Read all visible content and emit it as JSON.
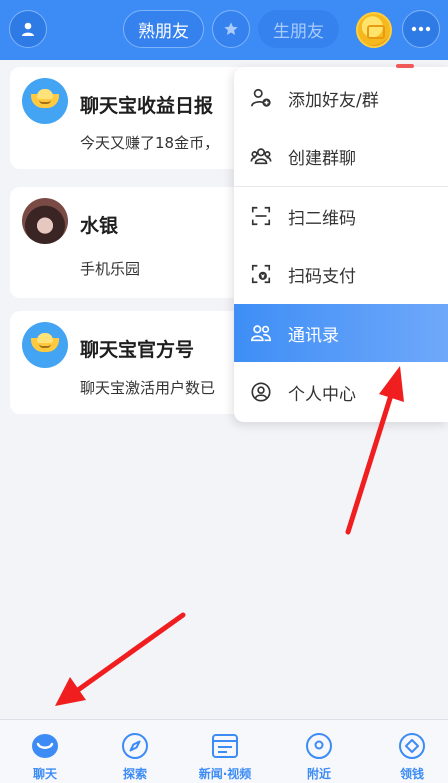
{
  "header": {
    "familiar_label": "熟朋友",
    "stranger_label": "生朋友",
    "avatar_icon": "user-icon",
    "star_icon": "star-icon",
    "coin_icon": "coin-icon",
    "more_icon": "more-dots-icon"
  },
  "chats": [
    {
      "title": "聊天宝收益日报",
      "preview": "今天又赚了18金币，",
      "avatar": "ingot-logo"
    },
    {
      "title": "水银",
      "preview": "手机乐园",
      "avatar": "user-photo"
    },
    {
      "title": "聊天宝官方号",
      "preview": "聊天宝激活用户数已",
      "avatar": "ingot-logo"
    }
  ],
  "menu": {
    "items": [
      {
        "label": "添加好友/群",
        "icon": "add-friend-icon"
      },
      {
        "label": "创建群聊",
        "icon": "group-chat-icon"
      },
      {
        "label": "扫二维码",
        "icon": "scan-qr-icon"
      },
      {
        "label": "扫码支付",
        "icon": "scan-pay-icon"
      },
      {
        "label": "通讯录",
        "icon": "contacts-icon",
        "highlighted": true
      },
      {
        "label": "个人中心",
        "icon": "profile-icon"
      }
    ]
  },
  "tabbar": {
    "items": [
      {
        "label": "聊天",
        "icon": "chat-icon"
      },
      {
        "label": "探索",
        "icon": "compass-icon"
      },
      {
        "label": "新闻·视频",
        "icon": "news-icon"
      },
      {
        "label": "附近",
        "icon": "location-icon"
      },
      {
        "label": "领钱",
        "icon": "diamond-icon"
      }
    ]
  },
  "colors": {
    "brand": "#3d8cf5",
    "highlight": "#5d9ff8",
    "arrow": "#f01e1e"
  }
}
